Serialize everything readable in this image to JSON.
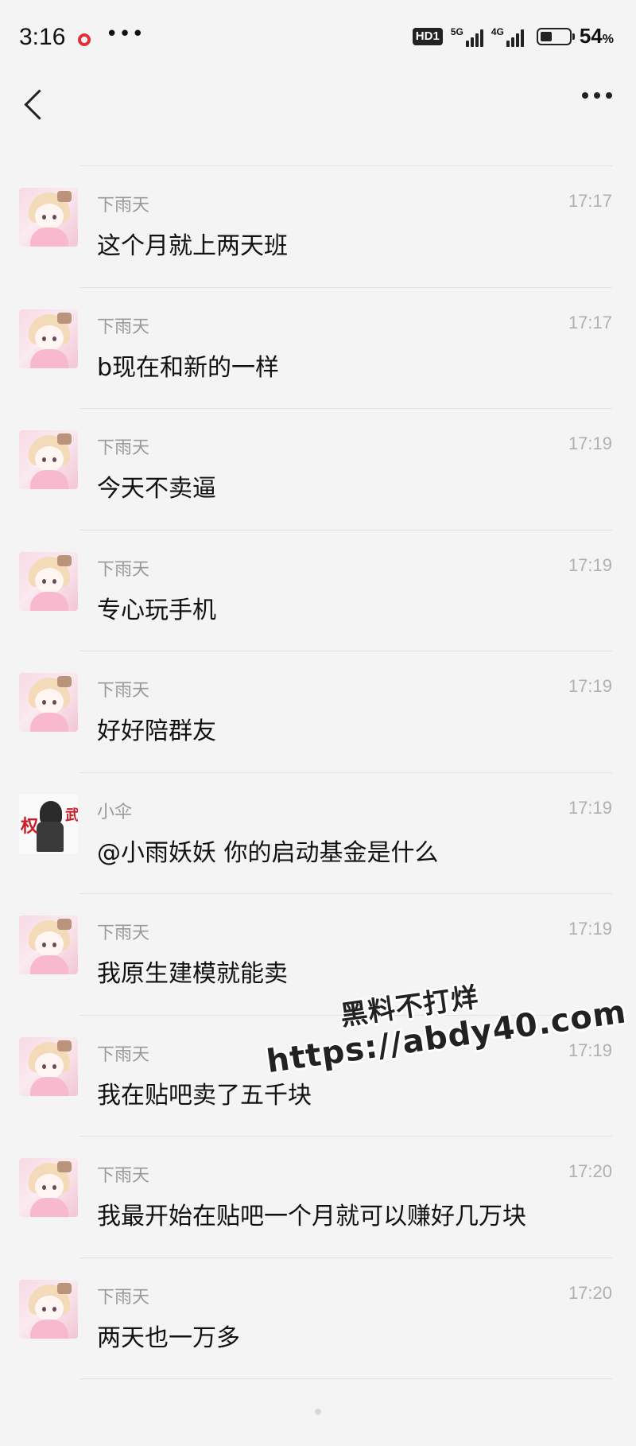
{
  "status": {
    "time": "3:16",
    "more": "•••",
    "hd": "HD1",
    "net1": "5G",
    "net2": "4G",
    "battery_pct": 54,
    "battery_label": "54",
    "battery_unit": "%"
  },
  "nav": {
    "back_icon": "chevron-left-icon",
    "menu_icon": "more-dots-icon"
  },
  "messages": [
    {
      "sender": "下雨天",
      "time": "17:17",
      "text": "这个月就上两天班",
      "avatar": "anime-girl"
    },
    {
      "sender": "下雨天",
      "time": "17:17",
      "text": "b现在和新的一样",
      "avatar": "anime-girl"
    },
    {
      "sender": "下雨天",
      "time": "17:19",
      "text": "今天不卖逼",
      "avatar": "anime-girl"
    },
    {
      "sender": "下雨天",
      "time": "17:19",
      "text": "专心玩手机",
      "avatar": "anime-girl"
    },
    {
      "sender": "下雨天",
      "time": "17:19",
      "text": "好好陪群友",
      "avatar": "anime-girl"
    },
    {
      "sender": "小伞",
      "time": "17:19",
      "text": "@小雨妖妖 你的启动基金是什么",
      "avatar": "dark-figure",
      "avatar_chars": [
        "权",
        "武"
      ]
    },
    {
      "sender": "下雨天",
      "time": "17:19",
      "text": "我原生建模就能卖",
      "avatar": "anime-girl"
    },
    {
      "sender": "下雨天",
      "time": "17:19",
      "text": "我在贴吧卖了五千块",
      "avatar": "anime-girl"
    },
    {
      "sender": "下雨天",
      "time": "17:20",
      "text": "我最开始在贴吧一个月就可以赚好几万块",
      "avatar": "anime-girl"
    },
    {
      "sender": "下雨天",
      "time": "17:20",
      "text": "两天也一万多",
      "avatar": "anime-girl"
    }
  ],
  "watermark": {
    "line1": "黑料不打烊",
    "line2": "https://abdy40.com"
  }
}
